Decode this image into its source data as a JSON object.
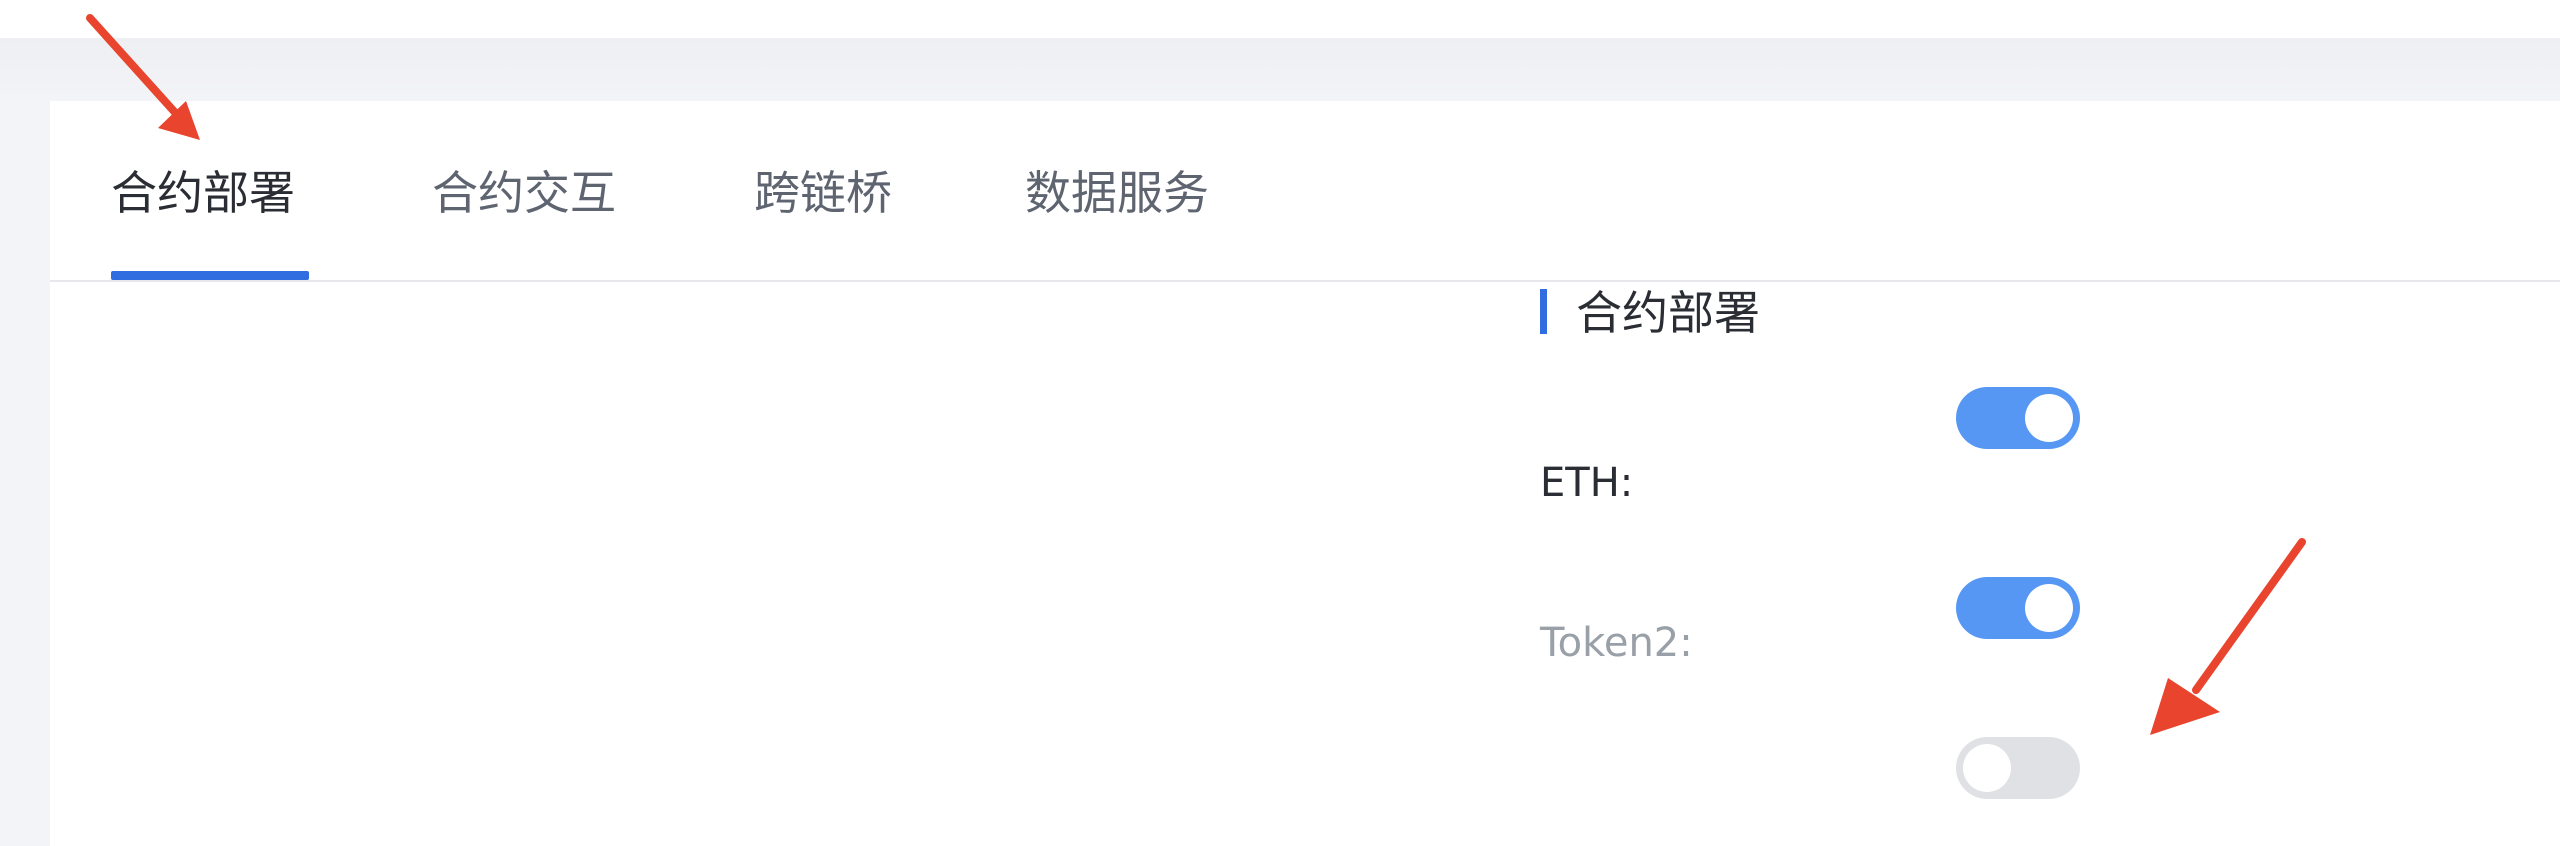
{
  "tabs": [
    {
      "label": "合约部署",
      "active": true
    },
    {
      "label": "合约交互",
      "active": false
    },
    {
      "label": "跨链桥",
      "active": false
    },
    {
      "label": "数据服务",
      "active": false
    }
  ],
  "section": {
    "title": "合约部署",
    "toggle_on": true
  },
  "settings": [
    {
      "label": "ETH:",
      "toggle_on": true
    },
    {
      "label": "Token2:",
      "toggle_on": false
    }
  ],
  "colors": {
    "accent": "#2f6de0",
    "switch_on": "#5797f4",
    "switch_off": "#dfe1e5",
    "annotation_arrow": "#e8442e"
  },
  "annotations": [
    "arrow-to-active-tab",
    "arrow-to-token2-toggle"
  ]
}
